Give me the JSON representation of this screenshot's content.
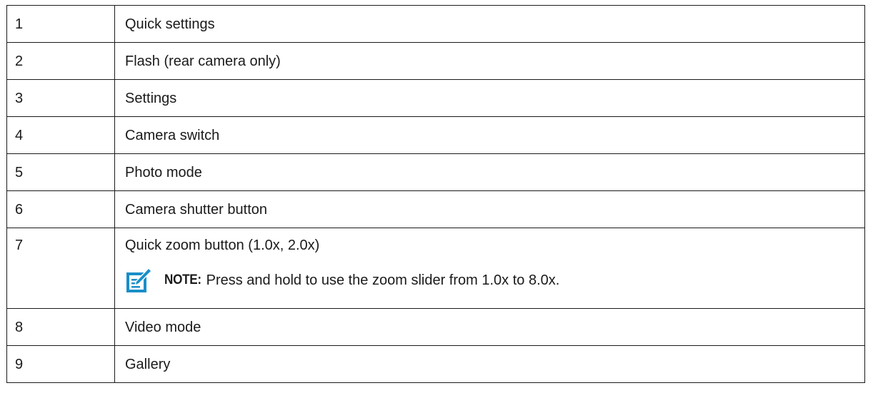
{
  "rows": [
    {
      "num": "1",
      "text": "Quick settings"
    },
    {
      "num": "2",
      "text": "Flash (rear camera only)"
    },
    {
      "num": "3",
      "text": "Settings"
    },
    {
      "num": "4",
      "text": "Camera switch"
    },
    {
      "num": "5",
      "text": "Photo mode"
    },
    {
      "num": "6",
      "text": "Camera shutter button"
    },
    {
      "num": "7",
      "text": "Quick zoom button (1.0x, 2.0x)"
    },
    {
      "num": "8",
      "text": "Video mode"
    },
    {
      "num": "9",
      "text": "Gallery"
    }
  ],
  "note": {
    "label": "NOTE:",
    "text": "Press and hold to use the zoom slider from 1.0x to 8.0x.",
    "icon": "note-pencil-icon",
    "icon_color": "#1a8ec8"
  }
}
